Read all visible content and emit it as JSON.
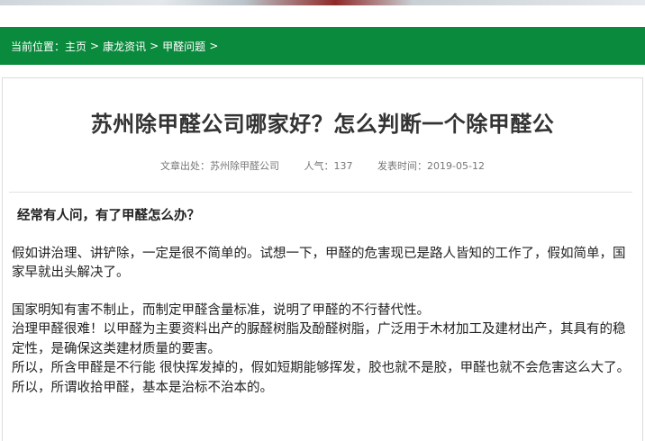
{
  "breadcrumb": {
    "prefix": "当前位置：",
    "items": [
      "主页",
      "康龙资讯",
      "甲醛问题"
    ],
    "separator": ">"
  },
  "article": {
    "title": "苏州除甲醛公司哪家好？怎么判断一个除甲醛公",
    "meta": {
      "source": "文章出处：苏州除甲醛公司",
      "views": "人气：137",
      "date": "发表时间：2019-05-12"
    },
    "lead": "经常有人问，有了甲醛怎么办？",
    "paragraphs": [
      "假如讲治理、讲铲除，一定是很不简单的。试想一下，甲醛的危害现已是路人皆知的工作了，假如简单，国家早就出头解决了。",
      "国家明知有害不制止，而制定甲醛含量标准，说明了甲醛的不行替代性。",
      "治理甲醛很难！以甲醛为主要资料出产的脲醛树脂及酚醛树脂，广泛用于木材加工及建材出产，其具有的稳定性，是确保这类建材质量的要害。",
      "所以，所含甲醛是不行能 很快挥发掉的，假如短期能够挥发，胶也就不是胶，甲醛也就不会危害这么大了。",
      "所以，所谓收拾甲醛，基本是治标不治本的。"
    ]
  }
}
